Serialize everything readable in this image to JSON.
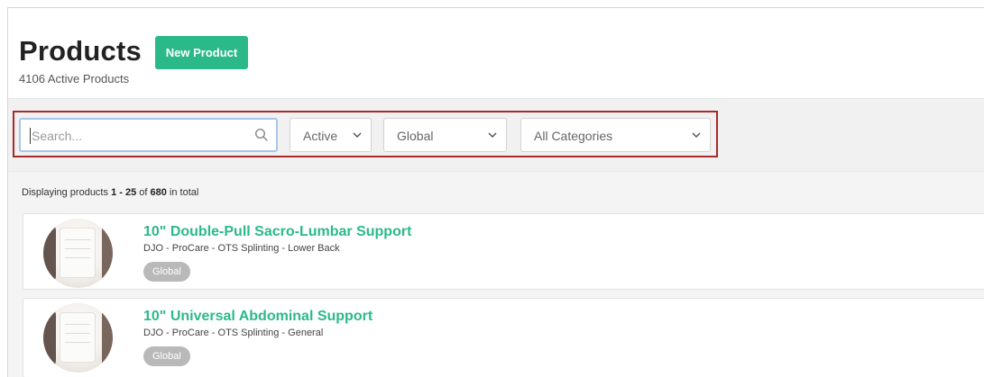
{
  "page": {
    "title": "Products",
    "subtitle": "4106 Active Products",
    "new_button_label": "New Product"
  },
  "filters": {
    "search_placeholder": "Search...",
    "status_value": "Active",
    "scope_value": "Global",
    "category_value": "All Categories"
  },
  "summary": {
    "prefix": "Displaying products ",
    "range": "1 - 25",
    "of_text": " of ",
    "total": "680",
    "suffix": " in total"
  },
  "products": [
    {
      "name": "10\" Double-Pull Sacro-Lumbar Support",
      "meta": "DJO - ProCare - OTS Splinting - Lower Back",
      "badge": "Global"
    },
    {
      "name": "10\" Universal Abdominal Support",
      "meta": "DJO - ProCare - OTS Splinting - General",
      "badge": "Global"
    }
  ],
  "colors": {
    "accent": "#2bb98a",
    "highlight_border": "#a92a2a",
    "badge": "#b9b9b9"
  },
  "icons": {
    "search": "search-icon",
    "dropdown": "chevron-down-icon"
  }
}
